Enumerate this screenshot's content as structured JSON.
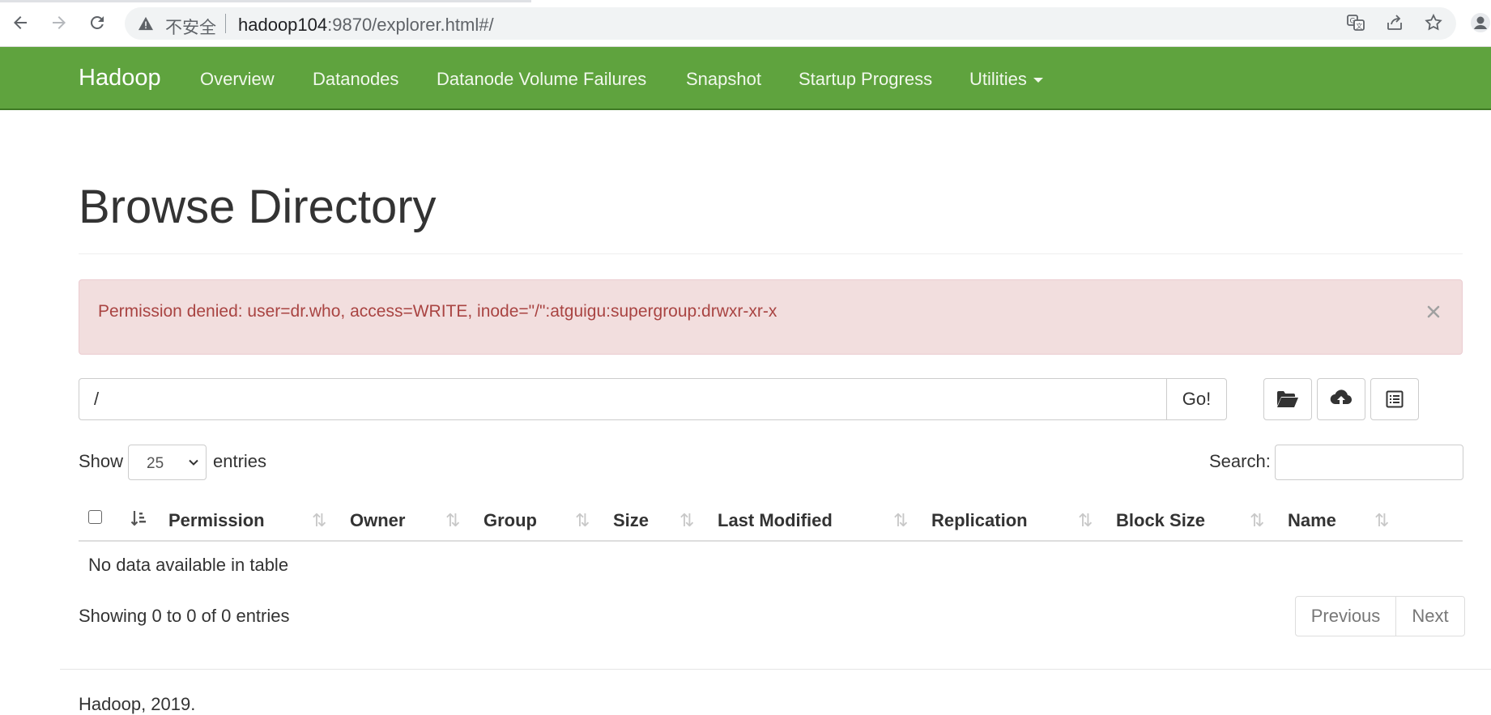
{
  "browser": {
    "security_label": "不安全",
    "url_host": "hadoop104",
    "url_rest": ":9870/explorer.html#/"
  },
  "navbar": {
    "brand": "Hadoop",
    "items": [
      "Overview",
      "Datanodes",
      "Datanode Volume Failures",
      "Snapshot",
      "Startup Progress",
      "Utilities"
    ],
    "background": "#5fa33e"
  },
  "page": {
    "title": "Browse Directory"
  },
  "alert": {
    "message": "Permission denied: user=dr.who, access=WRITE, inode=\"/\":atguigu:supergroup:drwxr-xr-x",
    "color": "#a94442",
    "background": "#f2dede"
  },
  "path_bar": {
    "value": "/",
    "go_label": "Go!"
  },
  "toolbar": {
    "icons": [
      "folder-open-icon",
      "cloud-upload-icon",
      "list-alt-icon"
    ]
  },
  "table_controls": {
    "show_label": "Show",
    "entries_value": "25",
    "entries_label": "entries",
    "search_label": "Search:"
  },
  "table": {
    "columns": [
      "Permission",
      "Owner",
      "Group",
      "Size",
      "Last Modified",
      "Replication",
      "Block Size",
      "Name"
    ],
    "empty_message": "No data available in table"
  },
  "footer_info": {
    "showing": "Showing 0 to 0 of 0 entries",
    "previous": "Previous",
    "next": "Next"
  },
  "footer": {
    "text": "Hadoop, 2019."
  }
}
